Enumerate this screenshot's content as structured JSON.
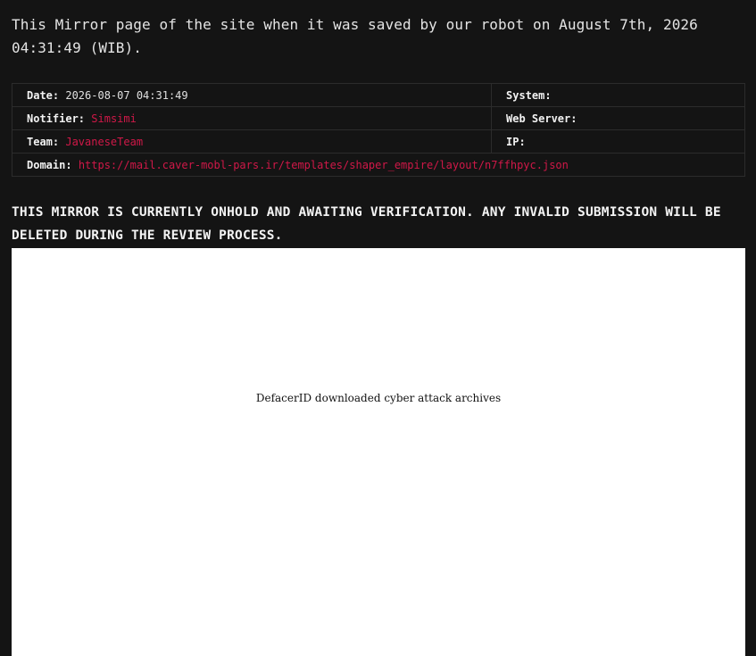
{
  "intro_text": "This Mirror page of the site when it was saved by our robot on August 7th, 2026 04:31:49 (WIB).",
  "info": {
    "date": {
      "label": "Date:",
      "value": "2026-08-07 04:31:49"
    },
    "notifier": {
      "label": "Notifier:",
      "value": "Simsimi"
    },
    "team": {
      "label": "Team:",
      "value": "JavaneseTeam"
    },
    "domain": {
      "label": "Domain:",
      "value": "https://mail.caver-mobl-pars.ir/templates/shaper_empire/layout/n7ffhpyc.json"
    },
    "system": {
      "label": "System:",
      "value": ""
    },
    "web_server": {
      "label": "Web Server:",
      "value": ""
    },
    "ip": {
      "label": "IP:",
      "value": ""
    }
  },
  "notice_text": "THIS MIRROR IS CURRENTLY ONHOLD AND AWAITING VERIFICATION. ANY INVALID SUBMISSION WILL BE DELETED DURING THE REVIEW PROCESS.",
  "mirror_frame": {
    "text": "DefacerID downloaded cyber attack archives"
  },
  "colors": {
    "background": "#141414",
    "accent_red": "#d01848",
    "frame_bg": "#ffffff"
  }
}
